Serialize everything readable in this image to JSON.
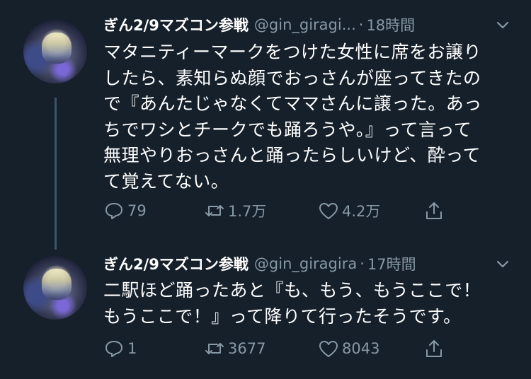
{
  "tweets": [
    {
      "name": "ぎん2/9マズコン参戦",
      "handle": "@gin_giragi...",
      "time": "18時間",
      "text": "マタニティーマークをつけた女性に席をお譲り\nしたら、素知らぬ顔でおっさんが座ってきたの\nで『あんたじゃなくてママさんに譲った。あっ\nちでワシとチークでも踊ろうや。』って言って\n無理やりおっさんと踊ったらしいけど、酔って\nて覚えてない。",
      "replies": "79",
      "retweets": "1.7万",
      "likes": "4.2万"
    },
    {
      "name": "ぎん2/9マズコン参戦",
      "handle": "@gin_giragira",
      "time": "17時間",
      "text": "二駅ほど踊ったあと『も、もう、もうここで！\nもうここで！』って降りて行ったそうです。",
      "replies": "1",
      "retweets": "3677",
      "likes": "8043"
    }
  ],
  "colors": {
    "background": "#15202b",
    "secondary": "#8899a6",
    "thread": "#3d5466"
  }
}
